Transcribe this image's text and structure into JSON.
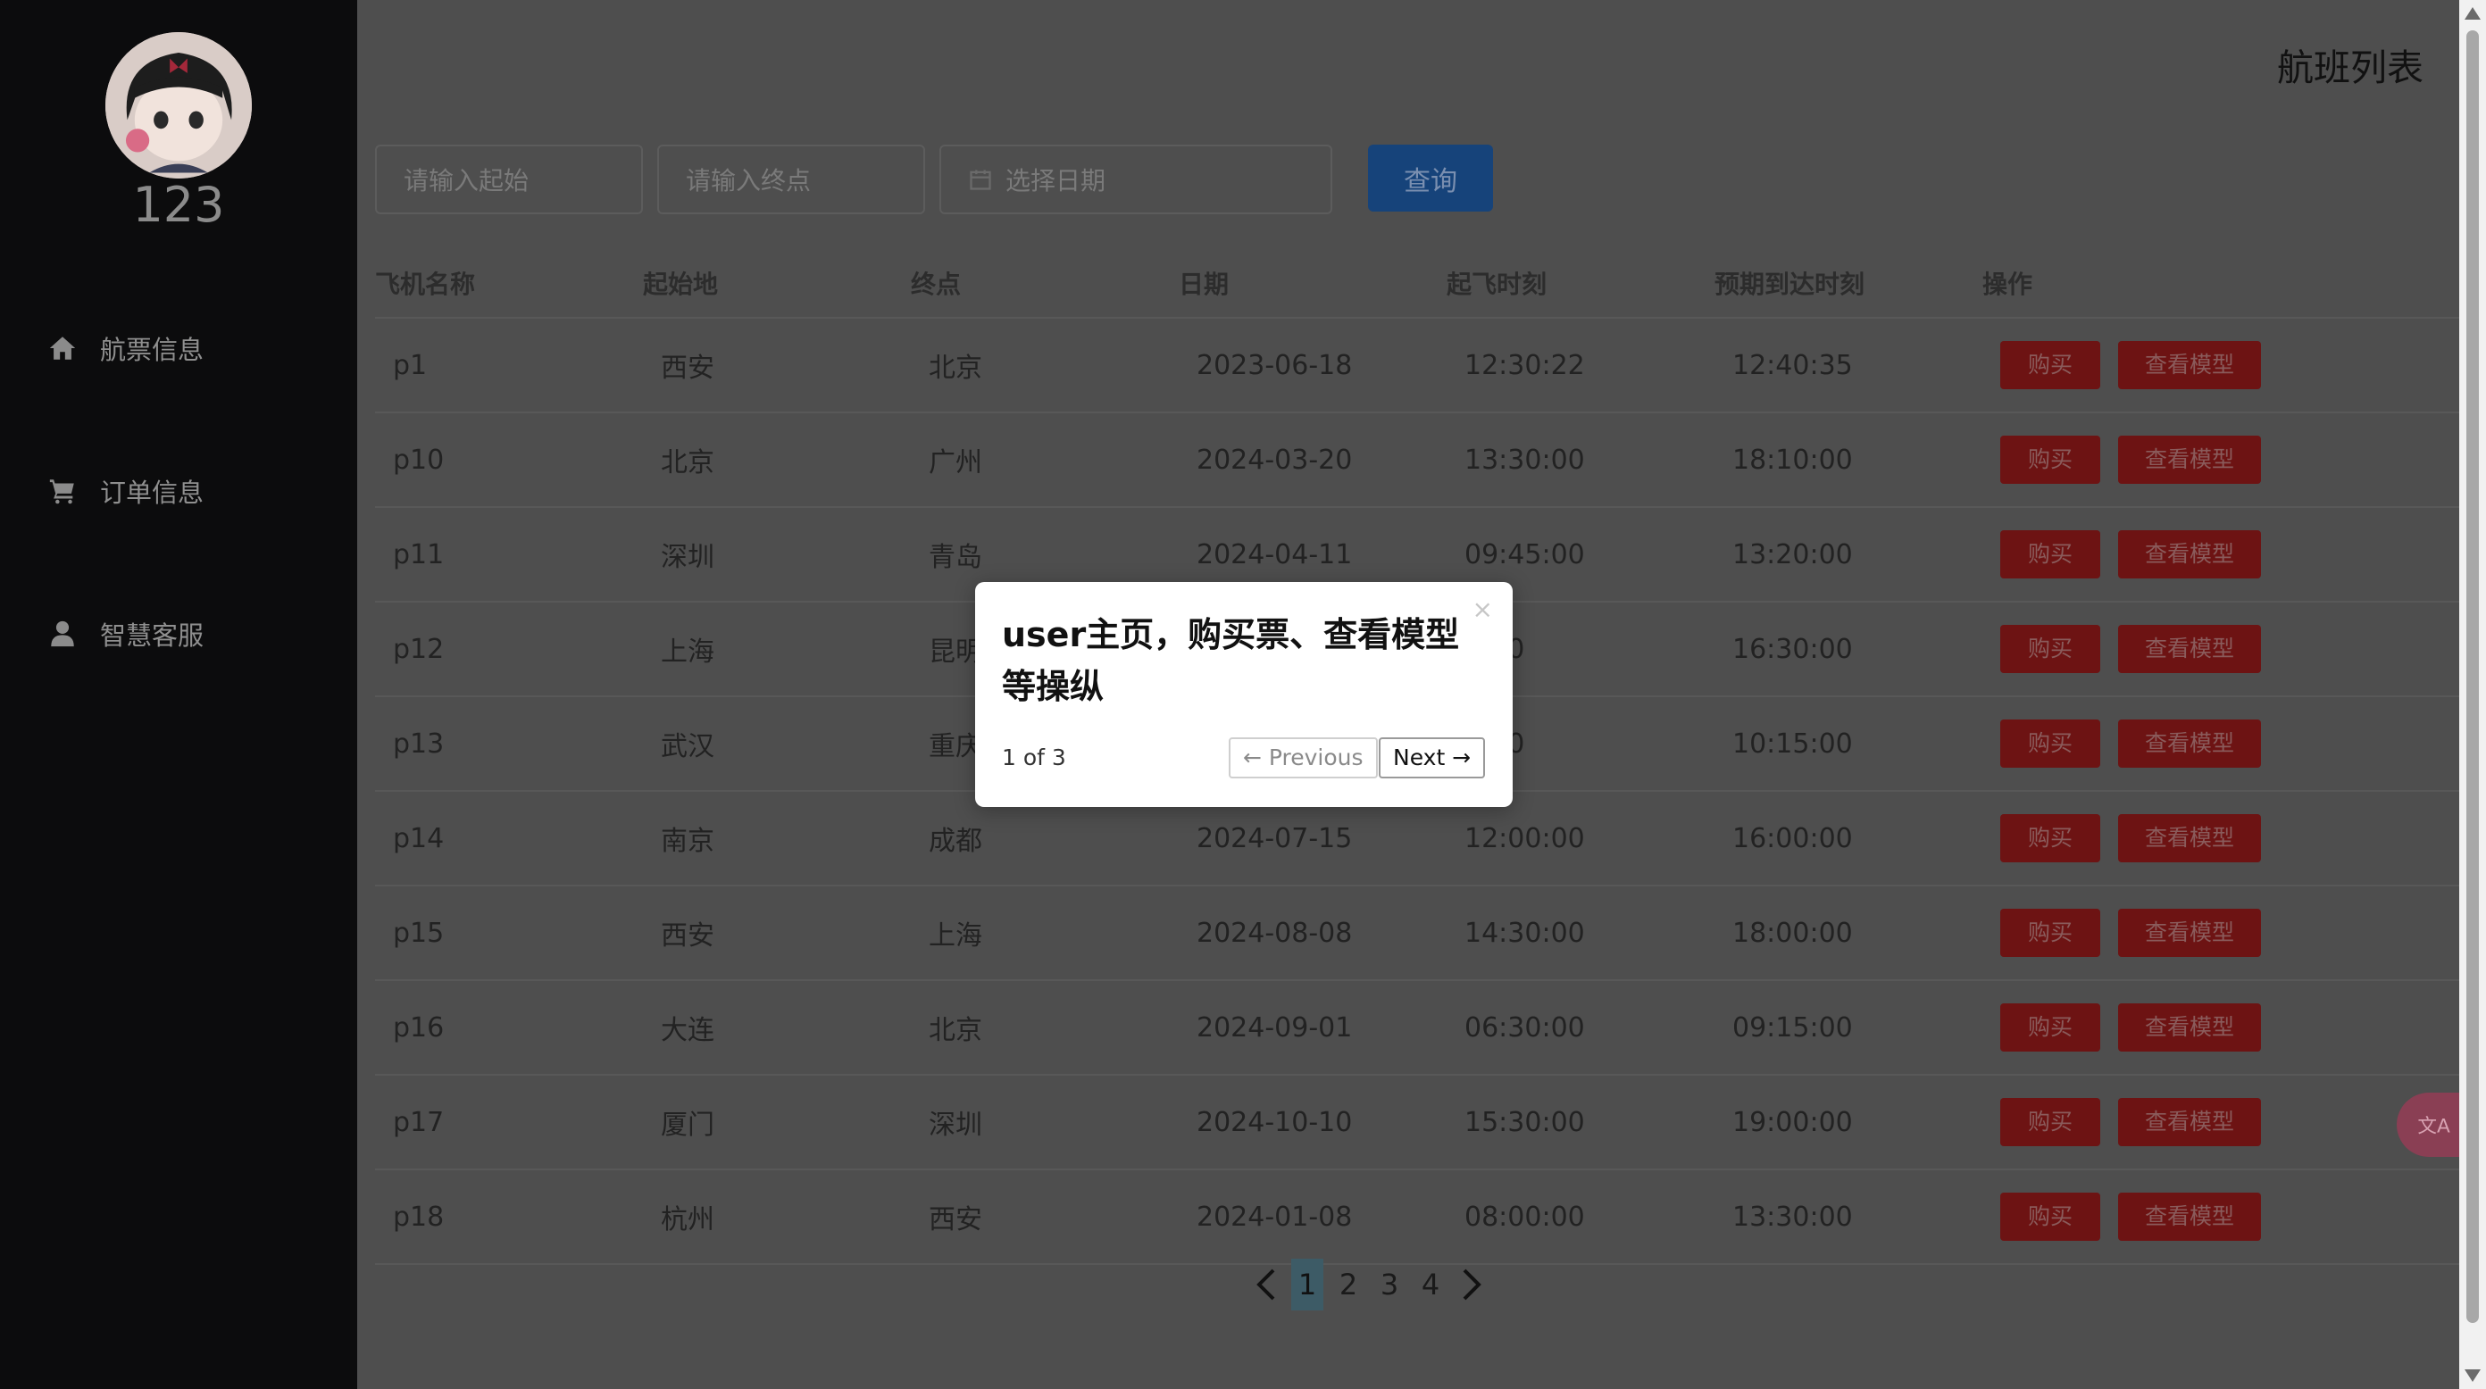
{
  "user": {
    "name": "123"
  },
  "nav": [
    {
      "label": "航票信息",
      "icon": "home-icon"
    },
    {
      "label": "订单信息",
      "icon": "cart-icon"
    },
    {
      "label": "智慧客服",
      "icon": "user-icon"
    }
  ],
  "page": {
    "title": "航班列表"
  },
  "search": {
    "origin_placeholder": "请输入起始",
    "destination_placeholder": "请输入终点",
    "date_placeholder": "选择日期",
    "button_label": "查询"
  },
  "table": {
    "headers": [
      "飞机名称",
      "起始地",
      "终点",
      "日期",
      "起飞时刻",
      "预期到达时刻",
      "操作"
    ],
    "buy_label": "购买",
    "view_label": "查看模型",
    "rows": [
      {
        "name": "p1",
        "from": "西安",
        "to": "北京",
        "date": "2023-06-18",
        "depart": "12:30:22",
        "arrive": "12:40:35"
      },
      {
        "name": "p10",
        "from": "北京",
        "to": "广州",
        "date": "2024-03-20",
        "depart": "13:30:00",
        "arrive": "18:10:00"
      },
      {
        "name": "p11",
        "from": "深圳",
        "to": "青岛",
        "date": "2024-04-11",
        "depart": "09:45:00",
        "arrive": "13:20:00"
      },
      {
        "name": "p12",
        "from": "上海",
        "to": "昆明",
        "date": "",
        "depart": "0:00",
        "arrive": "16:30:00"
      },
      {
        "name": "p13",
        "from": "武汉",
        "to": "重庆",
        "date": "",
        "depart": "0:00",
        "arrive": "10:15:00"
      },
      {
        "name": "p14",
        "from": "南京",
        "to": "成都",
        "date": "2024-07-15",
        "depart": "12:00:00",
        "arrive": "16:00:00"
      },
      {
        "name": "p15",
        "from": "西安",
        "to": "上海",
        "date": "2024-08-08",
        "depart": "14:30:00",
        "arrive": "18:00:00"
      },
      {
        "name": "p16",
        "from": "大连",
        "to": "北京",
        "date": "2024-09-01",
        "depart": "06:30:00",
        "arrive": "09:15:00"
      },
      {
        "name": "p17",
        "from": "厦门",
        "to": "深圳",
        "date": "2024-10-10",
        "depart": "15:30:00",
        "arrive": "19:00:00"
      },
      {
        "name": "p18",
        "from": "杭州",
        "to": "西安",
        "date": "2024-01-08",
        "depart": "08:00:00",
        "arrive": "13:30:00"
      }
    ]
  },
  "pagination": {
    "pages": [
      "1",
      "2",
      "3",
      "4"
    ],
    "current": "1"
  },
  "popover": {
    "title": "user主页，购买票、查看模型等操纵",
    "progress": "1 of 3",
    "prev_label": "← Previous",
    "next_label": "Next →",
    "close_label": "×"
  },
  "colors": {
    "sidebar_bg": "#0c0c0d",
    "overlay_bg": "#4e4e4e",
    "primary_button": "#16437a",
    "danger_button": "#6d1313"
  }
}
